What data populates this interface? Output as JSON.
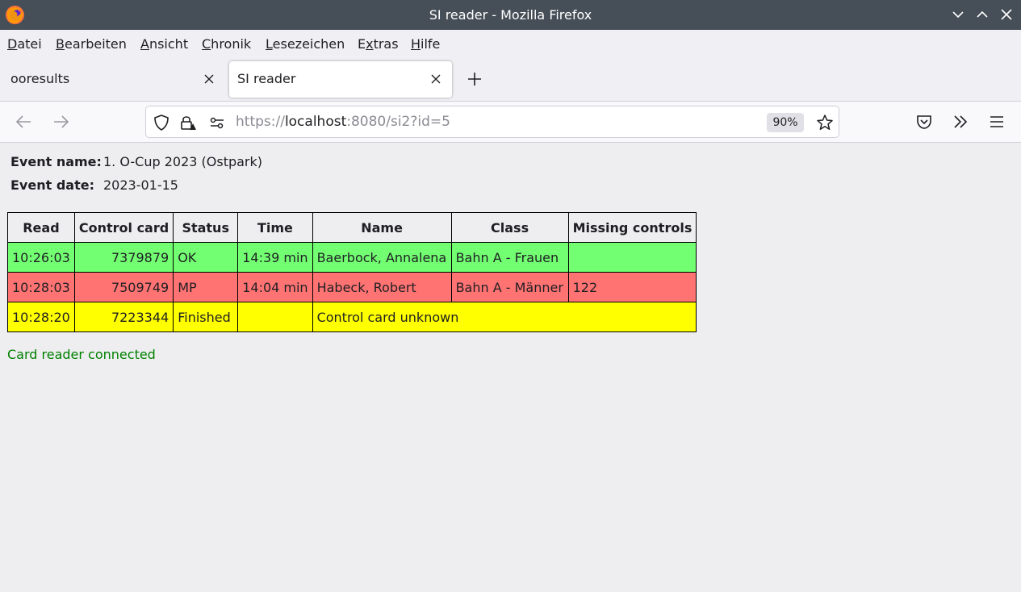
{
  "window": {
    "title": "SI reader - Mozilla Firefox"
  },
  "menu": [
    {
      "pre": "",
      "u": "D",
      "post": "atei"
    },
    {
      "pre": "",
      "u": "B",
      "post": "earbeiten"
    },
    {
      "pre": "",
      "u": "A",
      "post": "nsicht"
    },
    {
      "pre": "",
      "u": "C",
      "post": "hronik"
    },
    {
      "pre": "",
      "u": "L",
      "post": "esezeichen"
    },
    {
      "pre": "E",
      "u": "x",
      "post": "tras"
    },
    {
      "pre": "",
      "u": "H",
      "post": "ilfe"
    }
  ],
  "tabs": [
    {
      "label": "ooresults",
      "active": false
    },
    {
      "label": "SI reader",
      "active": true
    }
  ],
  "urlbar": {
    "scheme": "https://",
    "host": "localhost",
    "rest": ":8080/si2?id=5",
    "zoom": "90%"
  },
  "event": {
    "name_label": "Event name:",
    "name": "1. O-Cup 2023 (Ostpark)",
    "date_label": "Event date:",
    "date": "2023-01-15"
  },
  "table": {
    "headers": [
      "Read",
      "Control card",
      "Status",
      "Time",
      "Name",
      "Class",
      "Missing controls"
    ],
    "rows": [
      {
        "read": "10:26:03",
        "card": "7379879",
        "status": "OK",
        "time": "14:39 min",
        "name": "Baerbock, Annalena",
        "class": "Bahn A - Frauen",
        "missing": ""
      },
      {
        "read": "10:28:03",
        "card": "7509749",
        "status": "MP",
        "time": "14:04 min",
        "name": "Habeck, Robert",
        "class": "Bahn A - Männer",
        "missing": "122"
      },
      {
        "read": "10:28:20",
        "card": "7223344",
        "status": "Finished",
        "time": "",
        "message": "Control card unknown"
      }
    ]
  },
  "status_text": "Card reader connected",
  "colors": {
    "ok_row": "#72ff72",
    "mp_row": "#ff7373",
    "finished_row": "#ffff00",
    "status_text": "#008000"
  }
}
